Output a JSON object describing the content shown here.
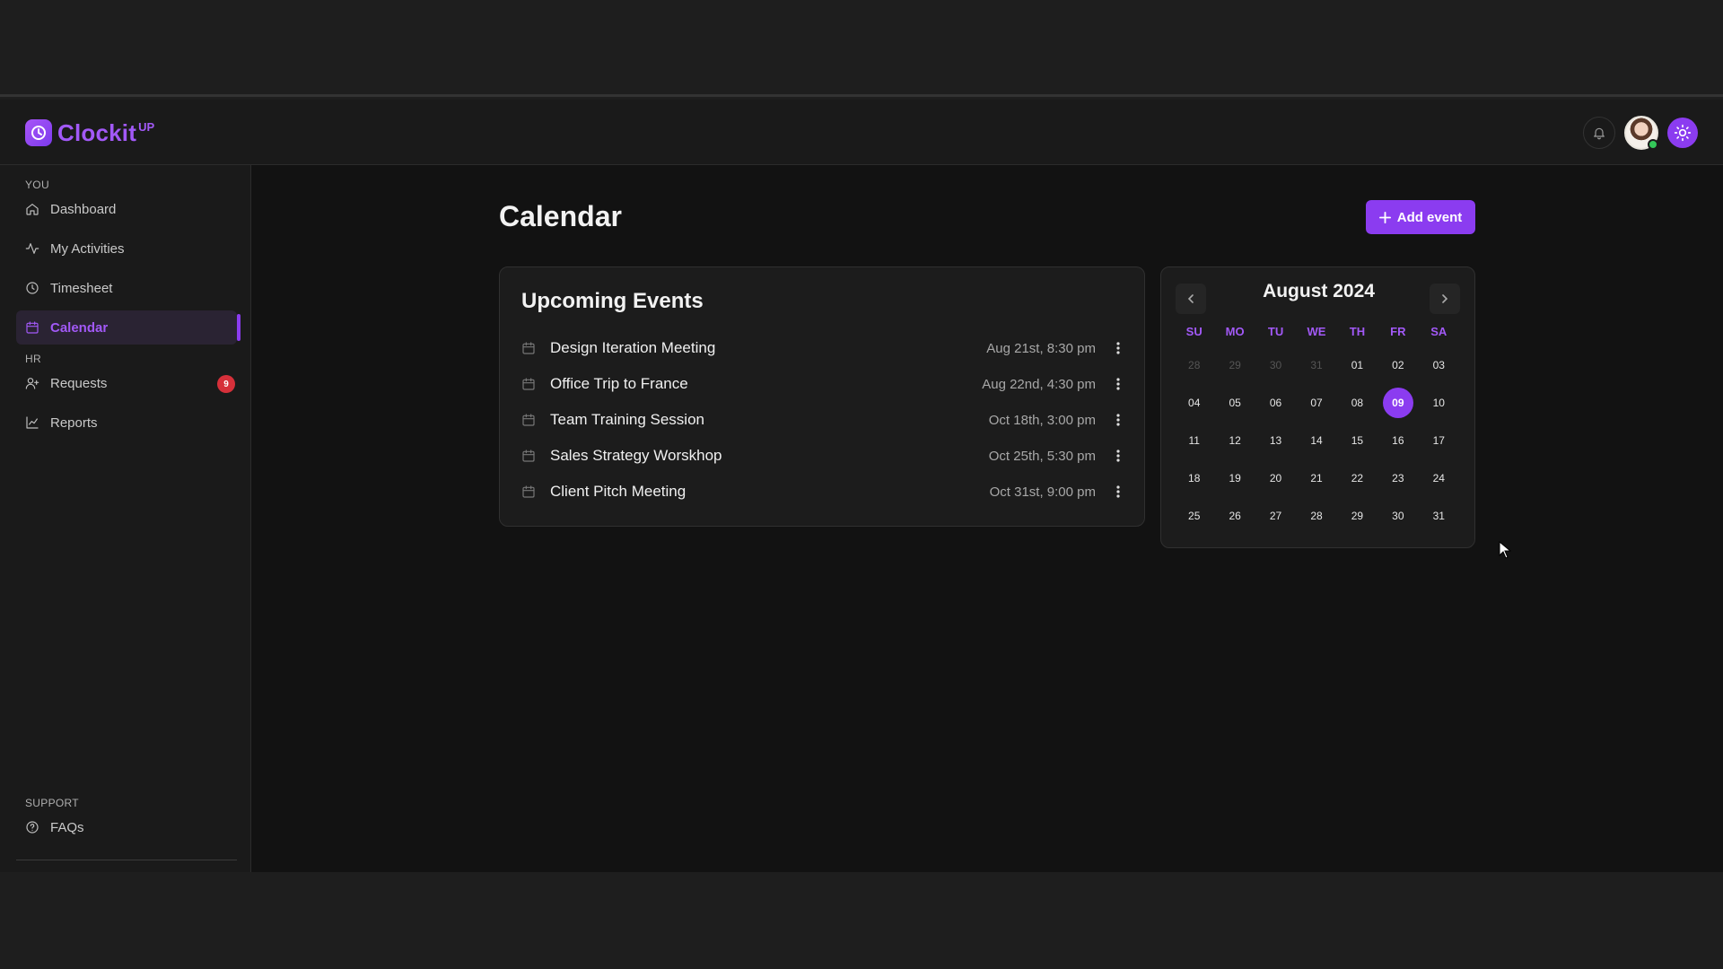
{
  "brand": {
    "name": "Clockit",
    "superscript": "UP",
    "accent": "#8b3cf0"
  },
  "header": {
    "icons": [
      "bell-icon",
      "user-avatar",
      "sun-icon"
    ]
  },
  "sidebar": {
    "sections": {
      "you": "YOU",
      "hr": "HR",
      "support": "SUPPORT"
    },
    "items": [
      {
        "label": "Dashboard",
        "icon": "home-icon"
      },
      {
        "label": "My Activities",
        "icon": "activity-icon"
      },
      {
        "label": "Timesheet",
        "icon": "clock-icon"
      },
      {
        "label": "Calendar",
        "icon": "calendar-icon",
        "active": true
      },
      {
        "label": "Requests",
        "icon": "user-plus-icon",
        "badge": "9"
      },
      {
        "label": "Reports",
        "icon": "chart-line-icon"
      },
      {
        "label": "FAQs",
        "icon": "help-circle-icon"
      }
    ]
  },
  "main": {
    "title": "Calendar",
    "add_button": "Add event",
    "events": {
      "title": "Upcoming Events",
      "items": [
        {
          "name": "Design Iteration Meeting",
          "date": "Aug 21st, 8:30 pm"
        },
        {
          "name": "Office Trip to France",
          "date": "Aug 22nd, 4:30 pm"
        },
        {
          "name": "Team Training Session",
          "date": "Oct 18th, 3:00 pm"
        },
        {
          "name": "Sales Strategy Worskhop",
          "date": "Oct 25th, 5:30 pm"
        },
        {
          "name": "Client Pitch Meeting",
          "date": "Oct 31st, 9:00 pm"
        }
      ]
    },
    "mini_calendar": {
      "title": "August 2024",
      "weekdays": [
        "SU",
        "MO",
        "TU",
        "WE",
        "TH",
        "FR",
        "SA"
      ],
      "days": [
        {
          "label": "28",
          "muted": true
        },
        {
          "label": "29",
          "muted": true
        },
        {
          "label": "30",
          "muted": true
        },
        {
          "label": "31",
          "muted": true
        },
        {
          "label": "01"
        },
        {
          "label": "02"
        },
        {
          "label": "03"
        },
        {
          "label": "04"
        },
        {
          "label": "05"
        },
        {
          "label": "06"
        },
        {
          "label": "07"
        },
        {
          "label": "08"
        },
        {
          "label": "09",
          "selected": true
        },
        {
          "label": "10"
        },
        {
          "label": "11"
        },
        {
          "label": "12"
        },
        {
          "label": "13"
        },
        {
          "label": "14"
        },
        {
          "label": "15"
        },
        {
          "label": "16"
        },
        {
          "label": "17"
        },
        {
          "label": "18"
        },
        {
          "label": "19"
        },
        {
          "label": "20"
        },
        {
          "label": "21"
        },
        {
          "label": "22"
        },
        {
          "label": "23"
        },
        {
          "label": "24"
        },
        {
          "label": "25"
        },
        {
          "label": "26"
        },
        {
          "label": "27"
        },
        {
          "label": "28"
        },
        {
          "label": "29"
        },
        {
          "label": "30"
        },
        {
          "label": "31"
        }
      ]
    }
  }
}
